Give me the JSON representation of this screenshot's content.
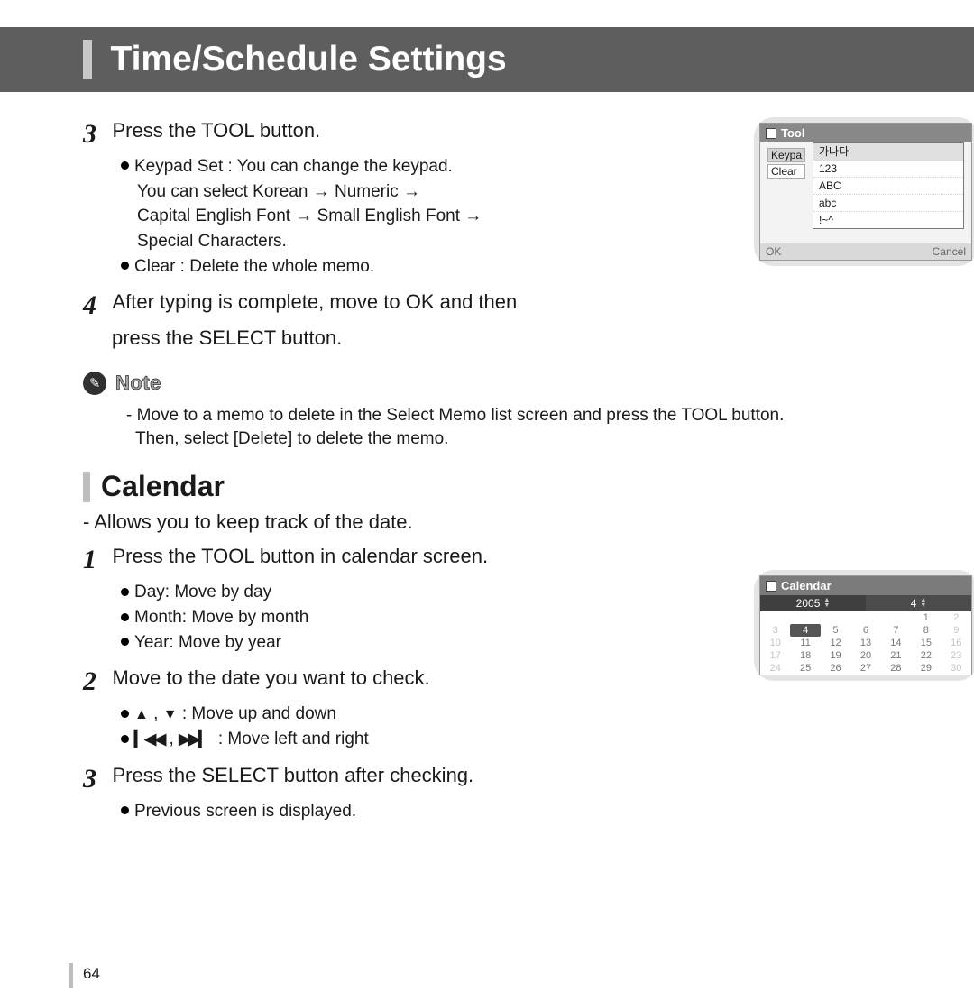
{
  "header": {
    "title": "Time/Schedule Settings"
  },
  "step3": {
    "num": "3",
    "text": "Press the TOOL button.",
    "b1": "Keypad Set : You can change the keypad.",
    "b1b": "You can select Korean → Numeric →",
    "b1c": "Capital English Font → Small English Font →",
    "b1d": "Special Characters.",
    "b2": "Clear : Delete the whole memo."
  },
  "step4": {
    "num": "4",
    "text": "After typing is complete, move to OK and then",
    "text2": "press the SELECT button."
  },
  "note": {
    "label": "Note",
    "body": "- Move to a memo to delete in the Select Memo list screen and press the TOOL button.",
    "body2": "Then, select [Delete] to delete the memo."
  },
  "calendar_section": {
    "heading": "Calendar",
    "intro": "- Allows you to keep track of the date.",
    "s1": {
      "num": "1",
      "text": "Press the TOOL button in calendar screen.",
      "b1": "Day: Move by day",
      "b2": "Month: Move by month",
      "b3": "Year: Move by year"
    },
    "s2": {
      "num": "2",
      "text": "Move to the date you want to check.",
      "b1": ": Move up and down",
      "b2": ": Move left and right"
    },
    "s3": {
      "num": "3",
      "text": "Press the SELECT button after checking.",
      "b1": "Previous screen is displayed."
    }
  },
  "tool_popup": {
    "title": "Tool",
    "side1": "Keypa",
    "side2": "Clear",
    "opts": {
      "o1": "가나다",
      "o2": "123",
      "o3": "ABC",
      "o4": "abc",
      "o5": "!~^"
    },
    "ok": "OK",
    "cancel": "Cancel"
  },
  "calendar_popup": {
    "title": "Calendar",
    "year": "2005",
    "month": "4",
    "days": {
      "r1": [
        "",
        "",
        "",
        "",
        "",
        "1",
        "2"
      ],
      "r2": [
        "3",
        "4",
        "5",
        "6",
        "7",
        "8",
        "9"
      ],
      "r3": [
        "10",
        "11",
        "12",
        "13",
        "14",
        "15",
        "16"
      ],
      "r4": [
        "17",
        "18",
        "19",
        "20",
        "21",
        "22",
        "23"
      ],
      "r5": [
        "24",
        "25",
        "26",
        "27",
        "28",
        "29",
        "30"
      ]
    }
  },
  "page": "64"
}
